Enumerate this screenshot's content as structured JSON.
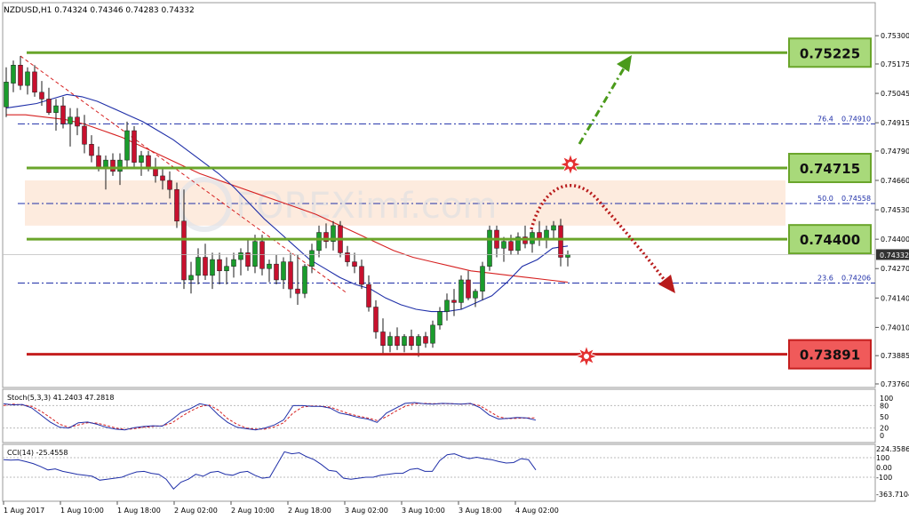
{
  "chart_data": {
    "type": "candlestick",
    "header": {
      "symbol": "NZDUSD,H1",
      "open": "0.74324",
      "high": "0.74346",
      "low": "0.74283",
      "close": "0.74332"
    },
    "price_axis": {
      "ylim": [
        0.7376,
        0.7534
      ],
      "ticks": [
        "0.75300",
        "0.75175",
        "0.75045",
        "0.74915",
        "0.74790",
        "0.74660",
        "0.74530",
        "0.74400",
        "0.74270",
        "0.74140",
        "0.74010",
        "0.73885",
        "0.73760"
      ],
      "current_price": "0.74332"
    },
    "time_axis": {
      "labels": [
        "1 Aug 2017",
        "1 Aug 10:00",
        "1 Aug 18:00",
        "2 Aug 02:00",
        "2 Aug 10:00",
        "2 Aug 18:00",
        "3 Aug 02:00",
        "3 Aug 10:00",
        "3 Aug 18:00",
        "4 Aug 02:00"
      ]
    },
    "candles": [
      [
        0.74985,
        0.7516,
        0.7494,
        0.75095
      ],
      [
        0.7509,
        0.7519,
        0.7505,
        0.7517
      ],
      [
        0.7517,
        0.7521,
        0.7506,
        0.7508
      ],
      [
        0.7508,
        0.7516,
        0.7504,
        0.7514
      ],
      [
        0.7514,
        0.7517,
        0.7503,
        0.7505
      ],
      [
        0.7505,
        0.751,
        0.7499,
        0.7502
      ],
      [
        0.7502,
        0.7507,
        0.7495,
        0.7496
      ],
      [
        0.7496,
        0.7502,
        0.7488,
        0.7499
      ],
      [
        0.7499,
        0.7503,
        0.7489,
        0.7491
      ],
      [
        0.7491,
        0.7498,
        0.7481,
        0.7494
      ],
      [
        0.7494,
        0.7498,
        0.7486,
        0.749
      ],
      [
        0.749,
        0.7495,
        0.7478,
        0.7482
      ],
      [
        0.7482,
        0.7486,
        0.7474,
        0.7477
      ],
      [
        0.7477,
        0.7481,
        0.747,
        0.7472
      ],
      [
        0.7472,
        0.7477,
        0.7462,
        0.7475
      ],
      [
        0.7475,
        0.7478,
        0.7468,
        0.747
      ],
      [
        0.747,
        0.7478,
        0.7464,
        0.7475
      ],
      [
        0.7475,
        0.7492,
        0.7472,
        0.7488
      ],
      [
        0.7488,
        0.749,
        0.7472,
        0.7474
      ],
      [
        0.7474,
        0.7479,
        0.7468,
        0.7477
      ],
      [
        0.7477,
        0.7479,
        0.747,
        0.7472
      ],
      [
        0.7472,
        0.7476,
        0.7465,
        0.7468
      ],
      [
        0.7468,
        0.7472,
        0.7462,
        0.7466
      ],
      [
        0.7466,
        0.747,
        0.7458,
        0.7462
      ],
      [
        0.7462,
        0.7465,
        0.7445,
        0.7448
      ],
      [
        0.7448,
        0.7462,
        0.7418,
        0.7422
      ],
      [
        0.7422,
        0.743,
        0.7416,
        0.7424
      ],
      [
        0.7424,
        0.7436,
        0.742,
        0.7432
      ],
      [
        0.7432,
        0.7438,
        0.7422,
        0.7424
      ],
      [
        0.7424,
        0.7434,
        0.7418,
        0.7431
      ],
      [
        0.7431,
        0.7434,
        0.742,
        0.7426
      ],
      [
        0.7426,
        0.7432,
        0.742,
        0.7428
      ],
      [
        0.7428,
        0.7434,
        0.7423,
        0.7431
      ],
      [
        0.7431,
        0.7436,
        0.7424,
        0.7434
      ],
      [
        0.7434,
        0.744,
        0.7426,
        0.7428
      ],
      [
        0.7428,
        0.7442,
        0.7425,
        0.7439
      ],
      [
        0.7439,
        0.7442,
        0.7424,
        0.7427
      ],
      [
        0.7427,
        0.7431,
        0.7421,
        0.7429
      ],
      [
        0.7429,
        0.7433,
        0.742,
        0.7422
      ],
      [
        0.7422,
        0.7432,
        0.7418,
        0.743
      ],
      [
        0.743,
        0.7434,
        0.7414,
        0.7418
      ],
      [
        0.7418,
        0.7433,
        0.7411,
        0.7416
      ],
      [
        0.7416,
        0.7429,
        0.7414,
        0.7428
      ],
      [
        0.7428,
        0.7438,
        0.7425,
        0.7435
      ],
      [
        0.7435,
        0.7446,
        0.7432,
        0.7443
      ],
      [
        0.7443,
        0.7447,
        0.7436,
        0.7439
      ],
      [
        0.7439,
        0.7448,
        0.7435,
        0.7446
      ],
      [
        0.7446,
        0.7448,
        0.7432,
        0.7434
      ],
      [
        0.7434,
        0.7437,
        0.7428,
        0.743
      ],
      [
        0.743,
        0.7434,
        0.7425,
        0.7428
      ],
      [
        0.7428,
        0.7431,
        0.7418,
        0.742
      ],
      [
        0.742,
        0.7424,
        0.7408,
        0.741
      ],
      [
        0.741,
        0.7413,
        0.7396,
        0.7399
      ],
      [
        0.7399,
        0.7405,
        0.7389,
        0.7393
      ],
      [
        0.7393,
        0.7399,
        0.739,
        0.7397
      ],
      [
        0.7397,
        0.7401,
        0.7391,
        0.7393
      ],
      [
        0.7393,
        0.7398,
        0.739,
        0.7397
      ],
      [
        0.7397,
        0.74,
        0.7391,
        0.7393
      ],
      [
        0.7393,
        0.7398,
        0.7388,
        0.7397
      ],
      [
        0.7397,
        0.7399,
        0.7392,
        0.7394
      ],
      [
        0.7394,
        0.7404,
        0.7392,
        0.7402
      ],
      [
        0.7402,
        0.741,
        0.74,
        0.7408
      ],
      [
        0.7408,
        0.7416,
        0.7404,
        0.7413
      ],
      [
        0.7413,
        0.7418,
        0.7406,
        0.7412
      ],
      [
        0.7412,
        0.7424,
        0.7409,
        0.7422
      ],
      [
        0.7422,
        0.7426,
        0.7413,
        0.7414
      ],
      [
        0.7414,
        0.7418,
        0.741,
        0.7417
      ],
      [
        0.7417,
        0.743,
        0.7413,
        0.7428
      ],
      [
        0.7428,
        0.7446,
        0.7426,
        0.7444
      ],
      [
        0.7444,
        0.7446,
        0.7432,
        0.7436
      ],
      [
        0.7436,
        0.7441,
        0.743,
        0.7439
      ],
      [
        0.7439,
        0.7442,
        0.7433,
        0.7435
      ],
      [
        0.7435,
        0.7443,
        0.7433,
        0.7441
      ],
      [
        0.7441,
        0.7446,
        0.7436,
        0.7438
      ],
      [
        0.7438,
        0.7444,
        0.7434,
        0.7443
      ],
      [
        0.7443,
        0.7448,
        0.7437,
        0.744
      ],
      [
        0.744,
        0.7446,
        0.7436,
        0.7444
      ],
      [
        0.7444,
        0.7448,
        0.744,
        0.7446
      ],
      [
        0.7446,
        0.7449,
        0.7428,
        0.7432
      ],
      [
        0.7432,
        0.7435,
        0.7428,
        0.74332
      ]
    ],
    "ma_fast": [
      0.7498,
      0.7499,
      0.75,
      0.7502,
      0.7504,
      0.7503,
      0.7501,
      0.7498,
      0.7495,
      0.7492,
      0.7488,
      0.7484,
      0.7479,
      0.7474,
      0.7469,
      0.7463,
      0.7456,
      0.7449,
      0.7443,
      0.7437,
      0.7431,
      0.7427,
      0.7423,
      0.742,
      0.7418,
      0.7414,
      0.7411,
      0.7409,
      0.7408,
      0.7408,
      0.7409,
      0.7412,
      0.7415,
      0.7421,
      0.7428,
      0.7431,
      0.7436,
      0.7437
    ],
    "ma_slow": [
      0.7495,
      0.7495,
      0.7494,
      0.7493,
      0.7491,
      0.7488,
      0.7485,
      0.7481,
      0.7477,
      0.7473,
      0.7469,
      0.7466,
      0.7463,
      0.746,
      0.7457,
      0.7454,
      0.7451,
      0.7447,
      0.7443,
      0.7439,
      0.7435,
      0.7432,
      0.743,
      0.7428,
      0.7426,
      0.7425,
      0.7424,
      0.7423,
      0.7422,
      0.7421
    ],
    "levels": [
      {
        "label": "0.75225",
        "price": 0.75225,
        "color": "#6aa52b",
        "box": "#a8d97a"
      },
      {
        "label": "0.74715",
        "price": 0.74715,
        "color": "#6aa52b",
        "box": "#a8d97a"
      },
      {
        "label": "0.74400",
        "price": 0.744,
        "color": "#6aa52b",
        "box": "#a8d97a"
      },
      {
        "label": "0.73891",
        "price": 0.73891,
        "color": "#c41e1e",
        "box": "#f05a5a"
      }
    ],
    "fib_levels": [
      {
        "ratio": "76.4",
        "value": "0.74910",
        "price": 0.7491
      },
      {
        "ratio": "50.0",
        "value": "0.74558",
        "price": 0.74558
      },
      {
        "ratio": "23.6",
        "value": "0.74206",
        "price": 0.74206
      }
    ],
    "zone": {
      "from": 0.7446,
      "to": 0.7466,
      "color": "#fde8d8"
    },
    "watermark": "FOREXimf.com",
    "colors": {
      "bull": "#1a9c2c",
      "bear": "#c8102e",
      "ma_fast": "#1f2fa8",
      "ma_slow": "#d62020",
      "grid": "#c8c8c8"
    },
    "stoch": {
      "label": "Stoch(5,3,3) 41.2403 47.2818",
      "ticks": [
        "100",
        "80",
        "50",
        "20",
        "0"
      ],
      "main": [
        85,
        82,
        83,
        74,
        55,
        36,
        22,
        20,
        34,
        36,
        30,
        22,
        17,
        15,
        21,
        24,
        26,
        25,
        42,
        62,
        72,
        85,
        80,
        55,
        35,
        22,
        18,
        15,
        20,
        28,
        42,
        80,
        80,
        78,
        78,
        73,
        60,
        55,
        48,
        44,
        35,
        60,
        73,
        86,
        88,
        85,
        84,
        86,
        85,
        84,
        86,
        75,
        55,
        44,
        46,
        48,
        47,
        41
      ],
      "signal": [
        80,
        84,
        82,
        78,
        65,
        48,
        30,
        22,
        28,
        34,
        33,
        27,
        20,
        16,
        18,
        22,
        24,
        26,
        33,
        50,
        65,
        77,
        82,
        68,
        45,
        30,
        20,
        17,
        17,
        23,
        34,
        60,
        76,
        79,
        78,
        76,
        67,
        58,
        52,
        47,
        40,
        50,
        65,
        78,
        85,
        86,
        85,
        85,
        85,
        84,
        85,
        80,
        65,
        50,
        45,
        46,
        47,
        47
      ]
    },
    "cci": {
      "label": "CCI(14) -25.4558",
      "ticks": [
        "224.3586",
        "100",
        "0.00",
        "-100",
        "-363.7104"
      ],
      "values": [
        80,
        75,
        78,
        60,
        40,
        10,
        -25,
        -15,
        -40,
        -55,
        -70,
        -80,
        -90,
        -130,
        -120,
        -110,
        -100,
        -70,
        -45,
        -40,
        -60,
        -70,
        -120,
        -220,
        -150,
        -120,
        -70,
        -90,
        -50,
        -40,
        -70,
        -80,
        -50,
        -40,
        -80,
        -110,
        -100,
        30,
        160,
        140,
        150,
        110,
        80,
        30,
        -30,
        -40,
        -110,
        -120,
        -110,
        -100,
        -100,
        -80,
        -70,
        -60,
        -60,
        -20,
        -10,
        -40,
        -40,
        70,
        130,
        140,
        110,
        90,
        105,
        90,
        80,
        60,
        45,
        50,
        90,
        80,
        -25
      ]
    }
  }
}
